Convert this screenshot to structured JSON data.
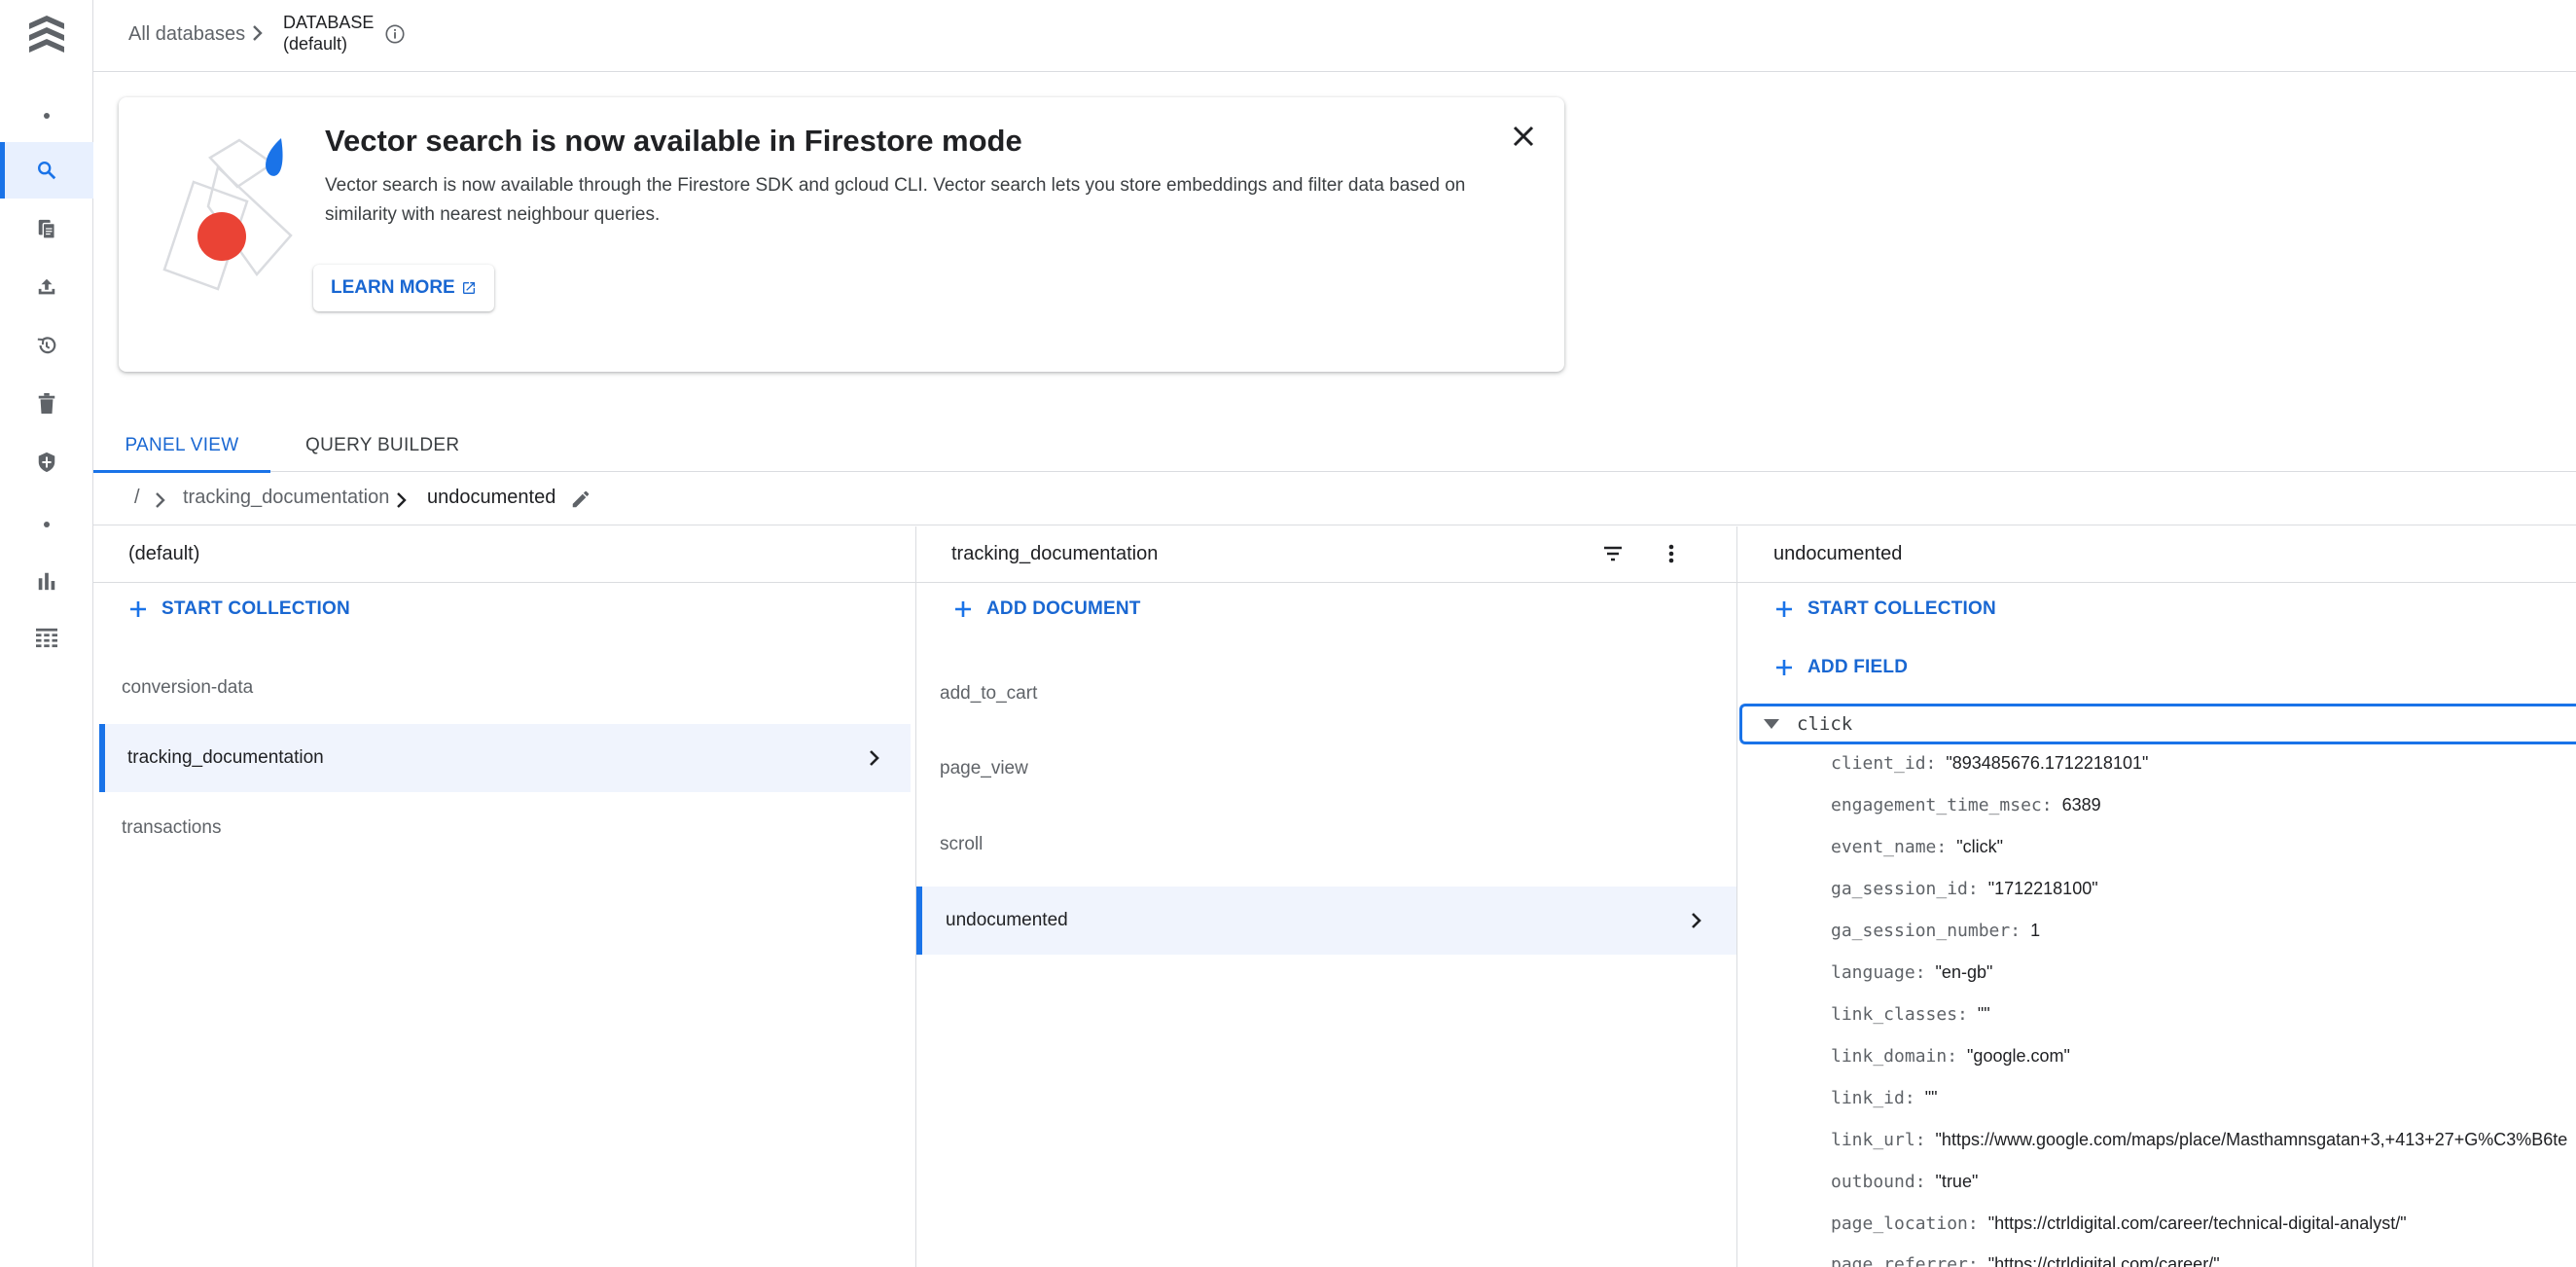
{
  "header": {
    "all_databases": "All databases",
    "database_label": "DATABASE",
    "database_name": "(default)"
  },
  "banner": {
    "title": "Vector search is now available in Firestore mode",
    "description": "Vector search is now available through the Firestore SDK and gcloud CLI. Vector search lets you store embeddings and filter data based on similarity with nearest neighbour queries.",
    "learn_more": "LEARN MORE"
  },
  "tabs": {
    "panel_view": "PANEL VIEW",
    "query_builder": "QUERY BUILDER"
  },
  "path": {
    "root": "/",
    "collection": "tracking_documentation",
    "document": "undocumented"
  },
  "columns": {
    "database": {
      "title": "(default)",
      "action": "START COLLECTION",
      "items": [
        "conversion-data",
        "tracking_documentation",
        "transactions"
      ]
    },
    "collection": {
      "title": "tracking_documentation",
      "action": "ADD DOCUMENT",
      "items": [
        "add_to_cart",
        "page_view",
        "scroll",
        "undocumented"
      ]
    },
    "document": {
      "title": "undocumented",
      "action_collection": "START COLLECTION",
      "action_field": "ADD FIELD",
      "map_field": "click",
      "fields": [
        {
          "key": "client_id:",
          "value": "\"893485676.1712218101\""
        },
        {
          "key": "engagement_time_msec:",
          "value": "6389"
        },
        {
          "key": "event_name:",
          "value": "\"click\""
        },
        {
          "key": "ga_session_id:",
          "value": "\"1712218100\""
        },
        {
          "key": "ga_session_number:",
          "value": "1"
        },
        {
          "key": "language:",
          "value": "\"en-gb\""
        },
        {
          "key": "link_classes:",
          "value": "\"\""
        },
        {
          "key": "link_domain:",
          "value": "\"google.com\""
        },
        {
          "key": "link_id:",
          "value": "\"\""
        },
        {
          "key": "link_url:",
          "value": "\"https://www.google.com/maps/place/Masthamnsgatan+3,+413+27+G%C3%B6te"
        },
        {
          "key": "outbound:",
          "value": "\"true\""
        },
        {
          "key": "page_location:",
          "value": "\"https://ctrldigital.com/career/technical-digital-analyst/\""
        },
        {
          "key": "page_referrer:",
          "value": "\"https://ctrldigital.com/career/\""
        }
      ]
    }
  },
  "colors": {
    "accent": "#1a73e8",
    "accent_text": "#1967d2",
    "selected_bg": "#f0f4fd",
    "illustration_red": "#ea4335"
  },
  "icons": {
    "rail": [
      "firestore-logo-icon",
      "dot-icon",
      "search-icon",
      "documents-icon",
      "upload-icon",
      "history-icon",
      "trash-icon",
      "shield-icon",
      "dot-icon",
      "bar-chart-icon",
      "table-icon"
    ]
  }
}
